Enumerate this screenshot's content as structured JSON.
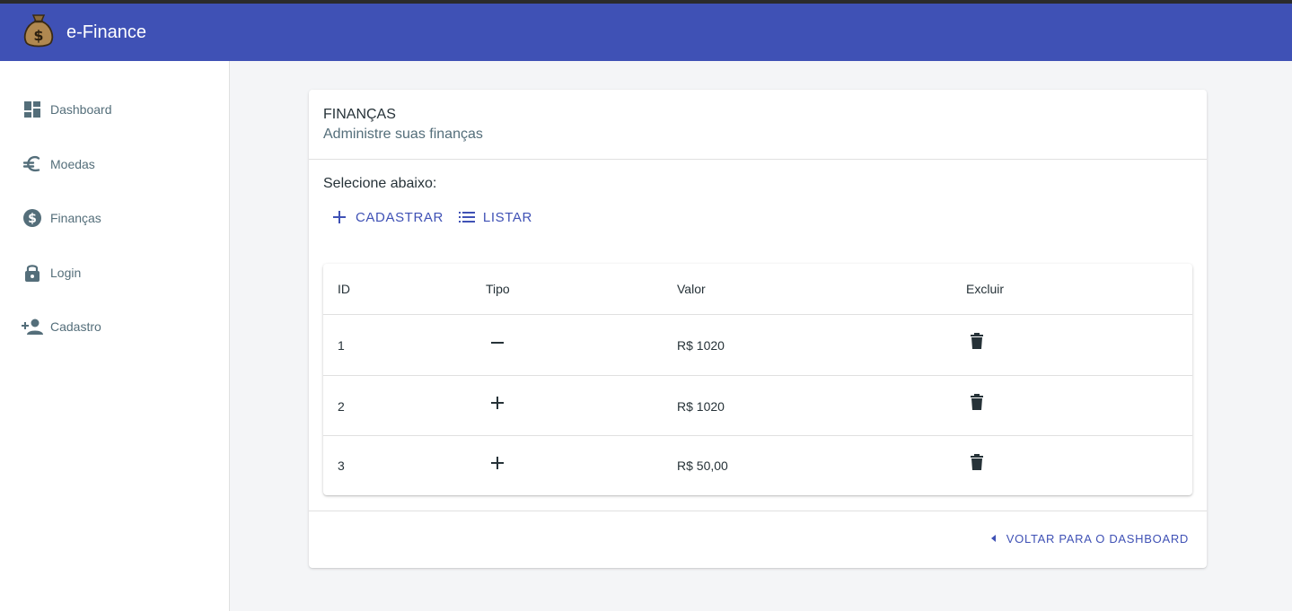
{
  "app": {
    "title": "e-Finance",
    "logo_icon": "money-bag-icon"
  },
  "colors": {
    "primary": "#3f51b5",
    "sidebar_text": "#546e7a",
    "text": "#263238",
    "background": "#f4f5f7"
  },
  "sidebar": {
    "items": [
      {
        "label": "Dashboard",
        "icon": "dashboard-icon"
      },
      {
        "label": "Moedas",
        "icon": "euro-icon"
      },
      {
        "label": "Finanças",
        "icon": "dollar-circle-icon"
      },
      {
        "label": "Login",
        "icon": "lock-icon"
      },
      {
        "label": "Cadastro",
        "icon": "person-add-icon"
      }
    ]
  },
  "card": {
    "title": "FINANÇAS",
    "subtitle": "Administre suas finanças",
    "select_label": "Selecione abaixo:",
    "actions": [
      {
        "label": "CADASTRAR",
        "icon": "plus-icon"
      },
      {
        "label": "LISTAR",
        "icon": "list-icon"
      }
    ],
    "table": {
      "headers": [
        "ID",
        "Tipo",
        "Valor",
        "Excluir"
      ],
      "rows": [
        {
          "id": "1",
          "tipo": "minus",
          "valor": "R$ 1020"
        },
        {
          "id": "2",
          "tipo": "plus",
          "valor": "R$ 1020"
        },
        {
          "id": "3",
          "tipo": "plus",
          "valor": "R$ 50,00"
        }
      ]
    },
    "back_label": "VOLTAR PARA O DASHBOARD"
  }
}
